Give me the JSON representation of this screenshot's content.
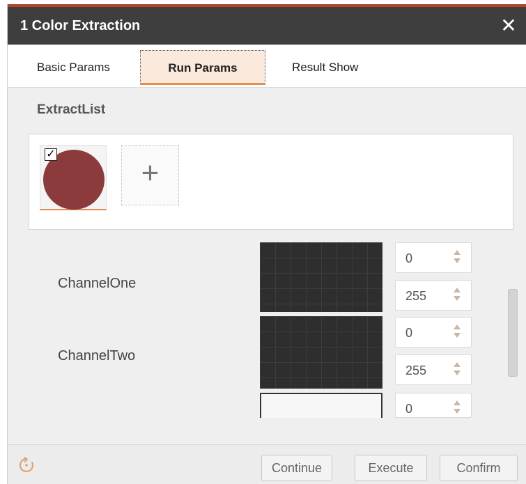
{
  "window": {
    "title": "1 Color Extraction",
    "close_glyph": "✕"
  },
  "tabs": [
    {
      "label": "Basic Params",
      "active": false
    },
    {
      "label": "Run Params",
      "active": true
    },
    {
      "label": "Result Show",
      "active": false
    }
  ],
  "extract_list": {
    "title": "ExtractList",
    "items": [
      {
        "color": "#8b3b3b",
        "checked": true,
        "check_glyph": "✓"
      }
    ],
    "add_glyph": "+"
  },
  "channels": [
    {
      "label": "ChannelOne",
      "min": "0",
      "max": "255"
    },
    {
      "label": "ChannelTwo",
      "min": "0",
      "max": "255"
    },
    {
      "label": "",
      "min": "0",
      "max": ""
    }
  ],
  "footer": {
    "reset_icon": "reset-icon",
    "buttons": {
      "continue": "Continue",
      "execute": "Execute",
      "confirm": "Confirm"
    }
  },
  "colors": {
    "titlebar": "#3e3e3e",
    "accent": "#e88c4c",
    "active_tab_bg": "#fbe9dc"
  }
}
